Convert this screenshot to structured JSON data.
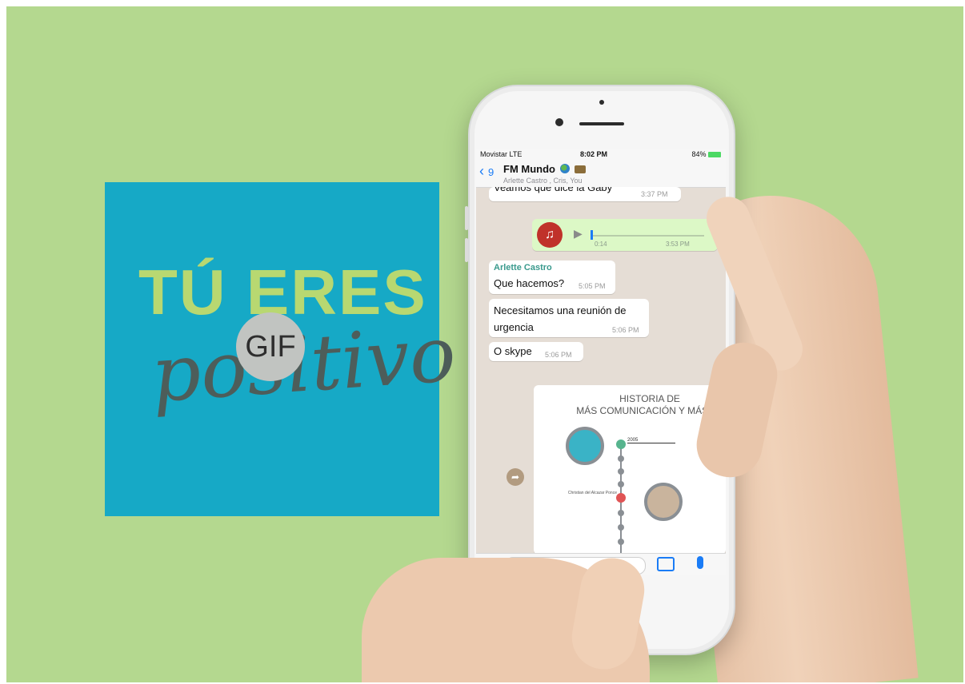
{
  "gif_card": {
    "line1": "TÚ ERES",
    "line2": "positivo",
    "badge": "GIF"
  },
  "phone": {
    "status_bar": {
      "carrier": "Movistar  LTE",
      "time": "8:02 PM",
      "battery": "84%"
    },
    "header": {
      "back_count": "9",
      "title": "FM Mundo",
      "subtitle": "Arlette Castro , Cris, You"
    },
    "messages": [
      {
        "text": "Veamos que dice la Gaby",
        "time": "3:37 PM"
      },
      {
        "sender": "Arlette Castro",
        "text": "Que hacemos?",
        "time": "5:05 PM"
      },
      {
        "text": "Necesitamos una reunión de urgencia",
        "time": "5:06 PM"
      },
      {
        "text": "O skype",
        "time": "5:06 PM"
      }
    ],
    "voice_note": {
      "duration": "0:14",
      "time": "3:53 PM"
    },
    "image_message": {
      "title_line1": "HISTORIA DE",
      "title_line2": "MÁS COMUNICACIÓN Y MÁS BT",
      "year": "2005",
      "person": "Christian del Alcazar Ponce"
    }
  },
  "colors": {
    "background": "#b4d88f",
    "gif_card": "#16a9c6",
    "accent_green": "#b8d871",
    "ios_blue": "#1a7cf6"
  }
}
